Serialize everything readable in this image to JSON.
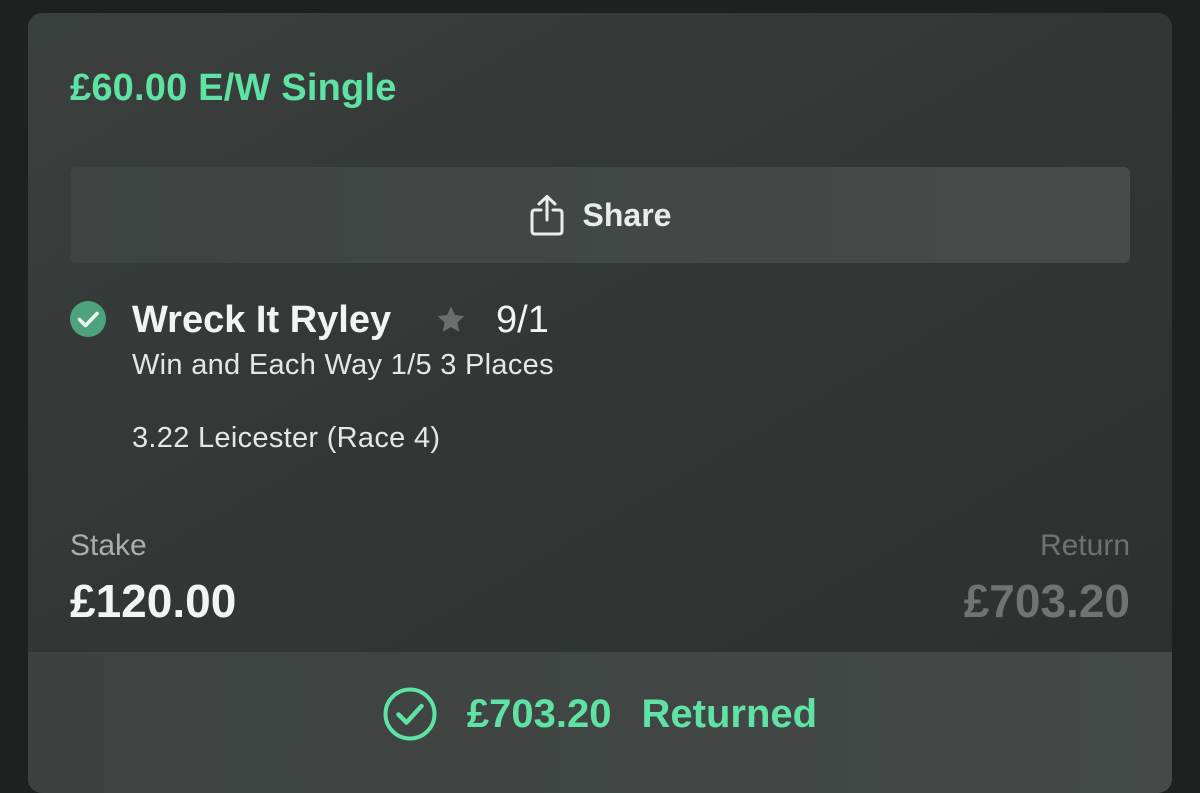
{
  "bet": {
    "title": "£60.00 E/W Single",
    "share_label": "Share",
    "share_icon": "share-icon"
  },
  "selection": {
    "status_icon": "check-circle-icon",
    "runner": "Wreck It Ryley",
    "favourite_icon": "star-icon",
    "odds": "9/1",
    "market": "Win and Each Way 1/5 3 Places",
    "event": "3.22 Leicester (Race 4)"
  },
  "totals": {
    "stake_label": "Stake",
    "stake_value": "£120.00",
    "return_label": "Return",
    "return_value": "£703.20"
  },
  "result": {
    "icon": "check-circle-outline-icon",
    "amount": "£703.20",
    "label": "Returned"
  },
  "colors": {
    "accent_green": "#5fe3a4",
    "check_fill": "#4ca37d",
    "card_bg": "#333735",
    "page_bg": "#1f2120"
  }
}
